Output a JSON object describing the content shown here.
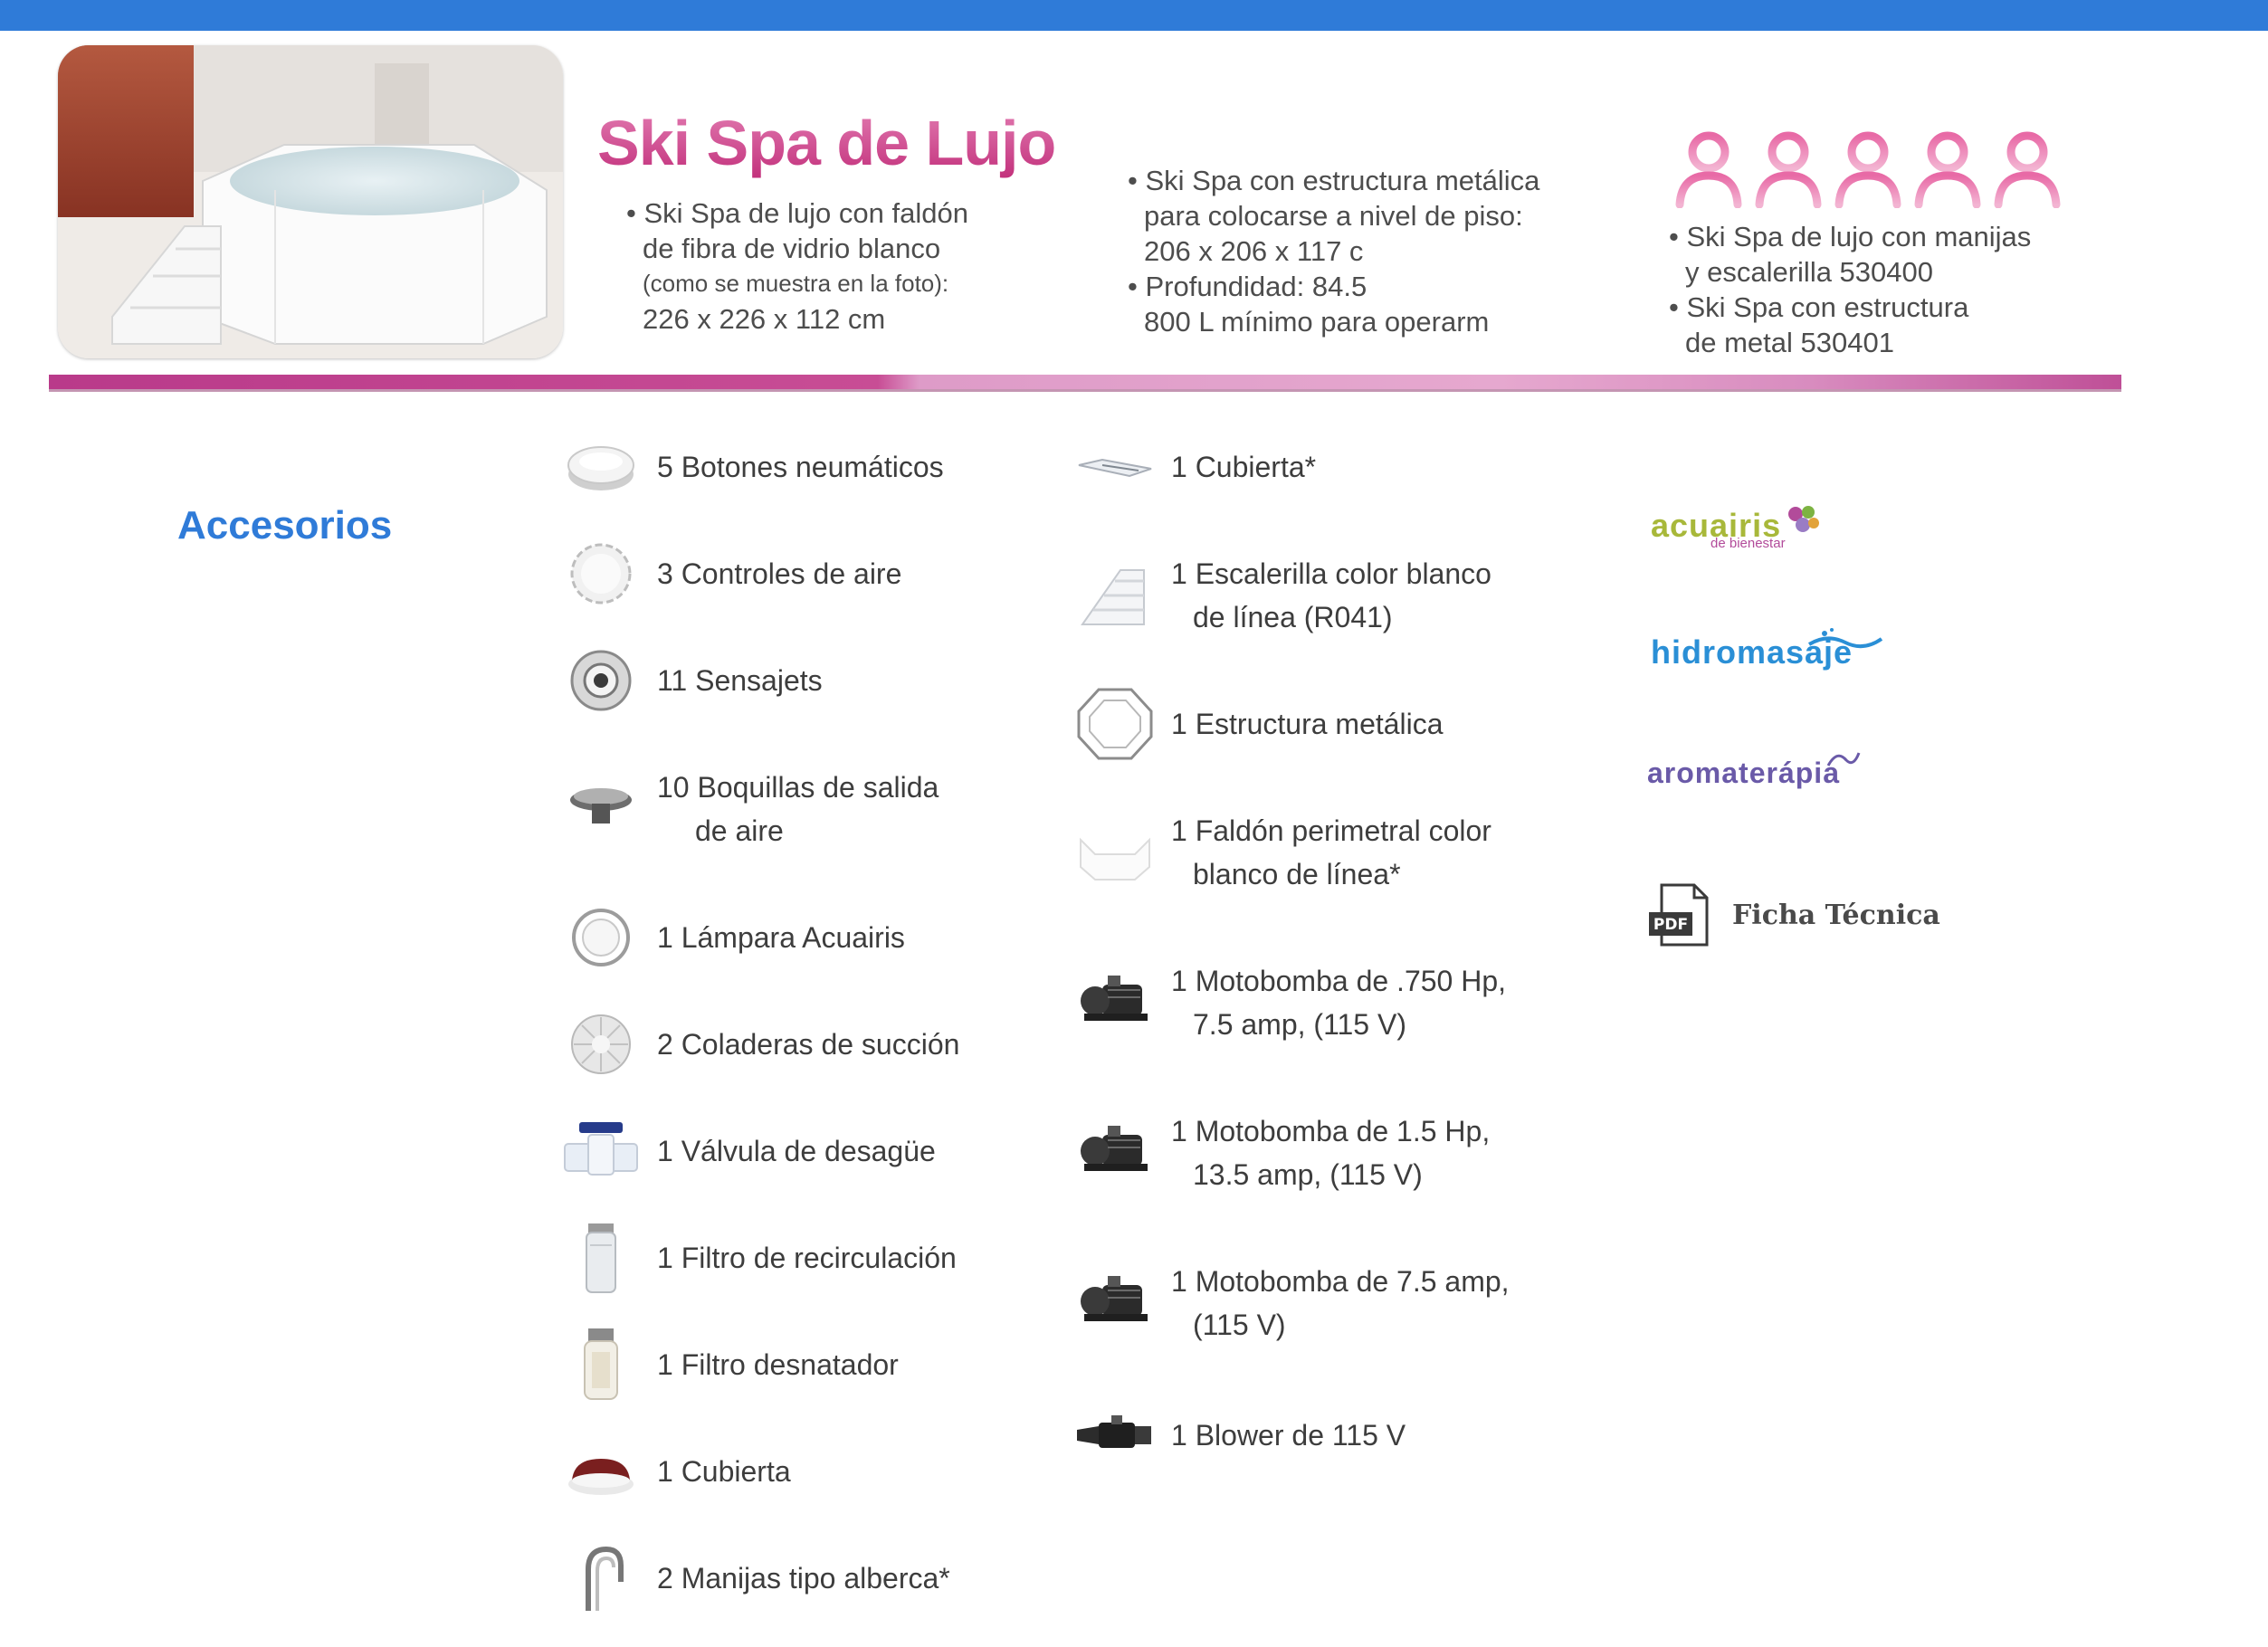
{
  "header": {
    "title": "Ski Spa de Lujo",
    "spec_1": [
      "• Ski Spa de lujo con faldón",
      "de fibra de vidrio blanco",
      "(como se muestra en la foto):",
      "226 x 226 x 112 cm"
    ],
    "spec_2": [
      "• Ski Spa con estructura metálica",
      "para colocarse a nivel de piso:",
      "206 x 206 x 117 c",
      "• Profundidad: 84.5",
      "800 L mínimo para operarm"
    ],
    "spec_3": [
      "• Ski Spa de lujo con manijas",
      "y escalerilla 530400",
      "• Ski Spa con estructura",
      "de metal 530401"
    ],
    "people_count": 5
  },
  "accessories": {
    "title": "Accesorios",
    "column_1": [
      {
        "icon": "button-icon",
        "lines": [
          "5 Botones neumáticos"
        ]
      },
      {
        "icon": "air-control-icon",
        "lines": [
          "3 Controles de aire"
        ]
      },
      {
        "icon": "jet-icon",
        "lines": [
          "11 Sensajets"
        ]
      },
      {
        "icon": "nozzle-icon",
        "lines": [
          "10 Boquillas de salida",
          "de aire"
        ]
      },
      {
        "icon": "lamp-icon",
        "lines": [
          "1 Lámpara Acuairis"
        ]
      },
      {
        "icon": "strainer-icon",
        "lines": [
          "2 Coladeras de succión"
        ]
      },
      {
        "icon": "valve-icon",
        "lines": [
          "1 Válvula de desagüe"
        ]
      },
      {
        "icon": "filter-icon",
        "lines": [
          "1 Filtro de recirculación"
        ]
      },
      {
        "icon": "skimmer-icon",
        "lines": [
          "1 Filtro desnatador"
        ]
      },
      {
        "icon": "cover-icon",
        "lines": [
          "1 Cubierta"
        ]
      },
      {
        "icon": "handle-icon",
        "lines": [
          "2 Manijas tipo alberca*"
        ]
      }
    ],
    "column_2": [
      {
        "icon": "cover-sheet-icon",
        "lines": [
          "1 Cubierta*"
        ]
      },
      {
        "icon": "stairs-icon",
        "lines": [
          "1 Escalerilla color blanco",
          "de línea (R041)"
        ]
      },
      {
        "icon": "frame-icon",
        "lines": [
          "1 Estructura metálica"
        ]
      },
      {
        "icon": "skirt-icon",
        "lines": [
          "1 Faldón perimetral color",
          "blanco de línea*"
        ]
      },
      {
        "icon": "pump-icon",
        "lines": [
          "1 Motobomba de .750 Hp,",
          "7.5 amp, (115 V)"
        ]
      },
      {
        "icon": "pump-icon",
        "lines": [
          "1 Motobomba de 1.5 Hp,",
          "13.5 amp, (115 V)"
        ]
      },
      {
        "icon": "pump-icon",
        "lines": [
          "1 Motobomba de 7.5 amp,",
          "(115 V)"
        ]
      },
      {
        "icon": "blower-icon",
        "lines": [
          "1 Blower de 115 V"
        ]
      }
    ]
  },
  "brands": {
    "acuairis": "acuairis",
    "acuairis_sub": "de bienestar",
    "hidromasaje": "hidromasaje",
    "aromaterapia": "aromaterápia"
  },
  "pdf": {
    "badge": "PDF",
    "label": "Ficha Técnica"
  },
  "colors": {
    "accent_blue": "#2f7bd8",
    "brand_pink": "#d4458f",
    "acuairis_green": "#a8b83a",
    "hidro_blue": "#2a8fd6",
    "aroma_purple": "#6a5aa8"
  }
}
